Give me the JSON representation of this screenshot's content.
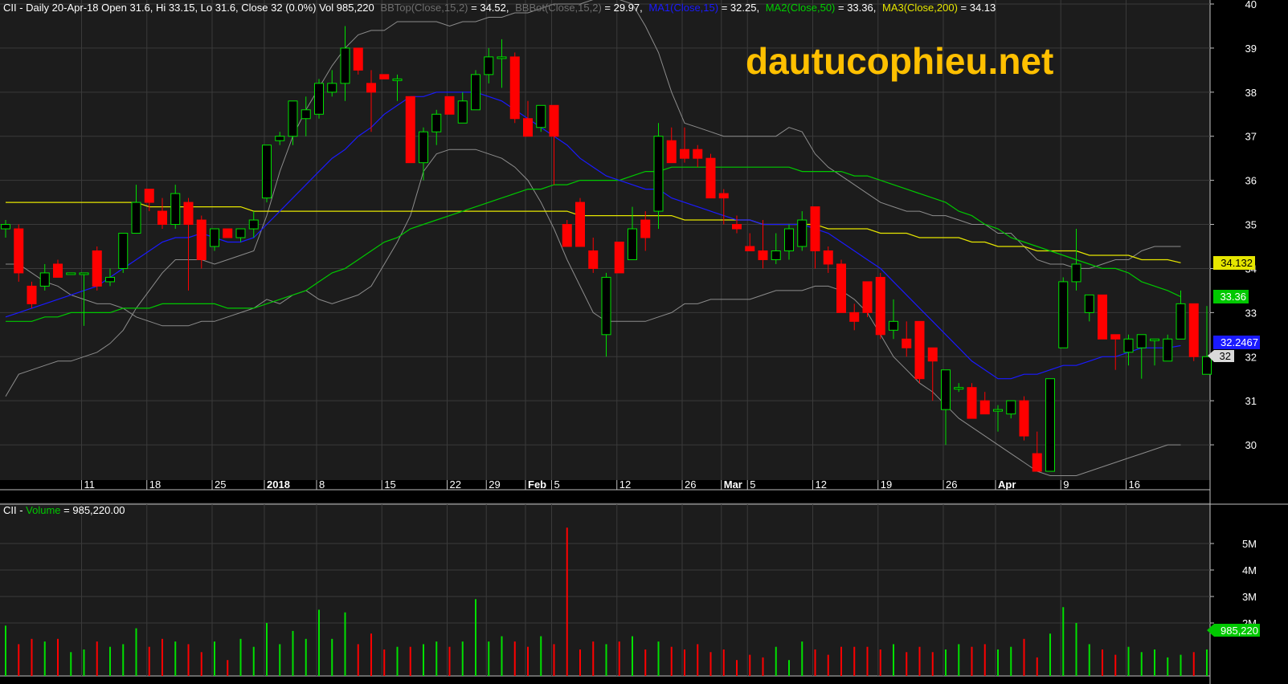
{
  "header": {
    "prefix": "CII - Daily 20-Apr-18 Open 31.6, Hi 33.15, Lo 31.6, Close 32 (0.0%) Vol 985,220",
    "bbtop_label": "BBTop(Close,15,2)",
    "bbtop_value": " = 34.52,",
    "bbbot_label": "BBBot(Close,15,2)",
    "bbbot_value": " = 29.97,",
    "ma1_label": "MA1(Close,15)",
    "ma1_value": " = 32.25,",
    "ma2_label": "MA2(Close,50)",
    "ma2_value": " = 33.36,",
    "ma3_label": "MA3(Close,200)",
    "ma3_value": " = 34.13"
  },
  "watermark": "dautucophieu.net",
  "volume_header": {
    "prefix": "CII - ",
    "label": "Volume",
    "value": " = 985,220.00"
  },
  "price_tags": {
    "ma3": "34.132",
    "ma2": "33.36",
    "ma1": "32.2467",
    "close": "32"
  },
  "volume_tag": "985,220",
  "colors": {
    "background": "#000000",
    "panel": "#1c1c1c",
    "grid": "#3a3a3a",
    "up": "#00e000",
    "down": "#ff0000",
    "bollinger": "#8c8c8c",
    "ma1": "#1a1aff",
    "ma2": "#00c800",
    "ma3": "#e6e600",
    "watermark": "#ffc000",
    "axis_text": "#ffffff"
  },
  "chart_data": {
    "type": "candlestick",
    "price_axis": {
      "ticks": [
        30,
        31,
        32,
        33,
        34,
        35,
        36,
        37,
        38,
        39,
        40
      ],
      "range": [
        29.2,
        40.0
      ]
    },
    "volume_axis": {
      "ticks": [
        "2M",
        "3M",
        "4M",
        "5M"
      ],
      "tick_values": [
        2,
        3,
        4,
        5
      ],
      "unit": "M"
    },
    "x_labels": [
      {
        "label": "11",
        "index": 6
      },
      {
        "label": "18",
        "index": 11
      },
      {
        "label": "25",
        "index": 16
      },
      {
        "label": "2018",
        "index": 20,
        "bold": true
      },
      {
        "label": "8",
        "index": 24
      },
      {
        "label": "15",
        "index": 29
      },
      {
        "label": "22",
        "index": 34
      },
      {
        "label": "29",
        "index": 37
      },
      {
        "label": "Feb",
        "index": 40,
        "bold": true
      },
      {
        "label": "5",
        "index": 42
      },
      {
        "label": "12",
        "index": 47
      },
      {
        "label": "26",
        "index": 52
      },
      {
        "label": "Mar",
        "index": 55,
        "bold": true
      },
      {
        "label": "5",
        "index": 57
      },
      {
        "label": "12",
        "index": 62
      },
      {
        "label": "19",
        "index": 67
      },
      {
        "label": "26",
        "index": 72
      },
      {
        "label": "Apr",
        "index": 76,
        "bold": true
      },
      {
        "label": "9",
        "index": 81
      },
      {
        "label": "16",
        "index": 86
      }
    ],
    "candles": [
      {
        "o": 34.9,
        "h": 35.1,
        "l": 34.7,
        "c": 35.0
      },
      {
        "o": 34.9,
        "h": 35.0,
        "l": 33.7,
        "c": 33.9
      },
      {
        "o": 33.6,
        "h": 33.7,
        "l": 33.1,
        "c": 33.2
      },
      {
        "o": 33.6,
        "h": 34.1,
        "l": 33.5,
        "c": 33.9
      },
      {
        "o": 34.1,
        "h": 34.2,
        "l": 33.8,
        "c": 33.8
      },
      {
        "o": 33.9,
        "h": 33.9,
        "l": 33.9,
        "c": 33.9
      },
      {
        "o": 33.9,
        "h": 33.9,
        "l": 32.7,
        "c": 33.9
      },
      {
        "o": 34.4,
        "h": 34.5,
        "l": 33.5,
        "c": 33.6
      },
      {
        "o": 33.7,
        "h": 34.0,
        "l": 33.6,
        "c": 33.8
      },
      {
        "o": 34.0,
        "h": 34.8,
        "l": 33.9,
        "c": 34.8
      },
      {
        "o": 34.8,
        "h": 35.9,
        "l": 34.8,
        "c": 35.5
      },
      {
        "o": 35.8,
        "h": 35.8,
        "l": 35.3,
        "c": 35.5
      },
      {
        "o": 35.3,
        "h": 35.6,
        "l": 34.9,
        "c": 35.0
      },
      {
        "o": 35.0,
        "h": 35.9,
        "l": 34.9,
        "c": 35.7
      },
      {
        "o": 35.5,
        "h": 35.6,
        "l": 33.5,
        "c": 35.0
      },
      {
        "o": 35.1,
        "h": 35.2,
        "l": 34.0,
        "c": 34.2
      },
      {
        "o": 34.5,
        "h": 34.9,
        "l": 34.4,
        "c": 34.9
      },
      {
        "o": 34.9,
        "h": 34.9,
        "l": 34.7,
        "c": 34.7
      },
      {
        "o": 34.7,
        "h": 34.9,
        "l": 34.6,
        "c": 34.9
      },
      {
        "o": 34.9,
        "h": 35.3,
        "l": 34.7,
        "c": 35.1
      },
      {
        "o": 35.6,
        "h": 36.8,
        "l": 35.5,
        "c": 36.8
      },
      {
        "o": 36.9,
        "h": 37.1,
        "l": 36.8,
        "c": 37.0
      },
      {
        "o": 37.0,
        "h": 37.8,
        "l": 36.8,
        "c": 37.8
      },
      {
        "o": 37.4,
        "h": 37.9,
        "l": 37.0,
        "c": 37.6
      },
      {
        "o": 37.5,
        "h": 38.3,
        "l": 37.4,
        "c": 38.2
      },
      {
        "o": 38.0,
        "h": 38.5,
        "l": 37.9,
        "c": 38.2
      },
      {
        "o": 38.2,
        "h": 39.5,
        "l": 37.8,
        "c": 39.0
      },
      {
        "o": 39.0,
        "h": 39.0,
        "l": 38.4,
        "c": 38.5
      },
      {
        "o": 38.2,
        "h": 38.5,
        "l": 37.1,
        "c": 38.0
      },
      {
        "o": 38.4,
        "h": 38.4,
        "l": 38.3,
        "c": 38.3
      },
      {
        "o": 38.3,
        "h": 38.4,
        "l": 37.8,
        "c": 38.3
      },
      {
        "o": 37.9,
        "h": 37.9,
        "l": 36.4,
        "c": 36.4
      },
      {
        "o": 36.4,
        "h": 37.2,
        "l": 36.0,
        "c": 37.1
      },
      {
        "o": 37.1,
        "h": 37.6,
        "l": 36.8,
        "c": 37.5
      },
      {
        "o": 37.9,
        "h": 37.9,
        "l": 37.5,
        "c": 37.5
      },
      {
        "o": 37.3,
        "h": 38.0,
        "l": 37.3,
        "c": 37.8
      },
      {
        "o": 37.6,
        "h": 38.5,
        "l": 37.6,
        "c": 38.4
      },
      {
        "o": 38.4,
        "h": 39.0,
        "l": 38.2,
        "c": 38.8
      },
      {
        "o": 38.8,
        "h": 39.2,
        "l": 38.1,
        "c": 38.8
      },
      {
        "o": 38.8,
        "h": 38.9,
        "l": 37.3,
        "c": 37.4
      },
      {
        "o": 37.4,
        "h": 37.8,
        "l": 37.0,
        "c": 37.0
      },
      {
        "o": 37.2,
        "h": 37.7,
        "l": 37.1,
        "c": 37.7
      },
      {
        "o": 37.7,
        "h": 37.7,
        "l": 35.9,
        "c": 37.0
      },
      {
        "o": 35.0,
        "h": 35.1,
        "l": 34.5,
        "c": 34.5
      },
      {
        "o": 35.5,
        "h": 35.6,
        "l": 34.5,
        "c": 34.5
      },
      {
        "o": 34.4,
        "h": 34.7,
        "l": 33.9,
        "c": 34.0
      },
      {
        "o": 32.5,
        "h": 33.9,
        "l": 32.0,
        "c": 33.8
      },
      {
        "o": 34.6,
        "h": 34.6,
        "l": 34.0,
        "c": 33.9
      },
      {
        "o": 34.2,
        "h": 35.4,
        "l": 34.2,
        "c": 34.9
      },
      {
        "o": 35.1,
        "h": 35.3,
        "l": 34.4,
        "c": 34.7
      },
      {
        "o": 35.3,
        "h": 37.3,
        "l": 34.9,
        "c": 37.0
      },
      {
        "o": 36.9,
        "h": 37.2,
        "l": 36.4,
        "c": 36.4
      },
      {
        "o": 36.7,
        "h": 37.2,
        "l": 36.4,
        "c": 36.5
      },
      {
        "o": 36.7,
        "h": 36.8,
        "l": 36.3,
        "c": 36.5
      },
      {
        "o": 36.5,
        "h": 36.6,
        "l": 35.6,
        "c": 35.6
      },
      {
        "o": 35.7,
        "h": 35.8,
        "l": 35.0,
        "c": 35.6
      },
      {
        "o": 35.0,
        "h": 35.2,
        "l": 34.8,
        "c": 34.9
      },
      {
        "o": 34.5,
        "h": 34.8,
        "l": 34.4,
        "c": 34.4
      },
      {
        "o": 34.4,
        "h": 35.1,
        "l": 34.0,
        "c": 34.2
      },
      {
        "o": 34.2,
        "h": 34.8,
        "l": 34.1,
        "c": 34.4
      },
      {
        "o": 34.4,
        "h": 35.0,
        "l": 34.2,
        "c": 34.9
      },
      {
        "o": 34.5,
        "h": 35.3,
        "l": 34.4,
        "c": 35.1
      },
      {
        "o": 35.4,
        "h": 35.4,
        "l": 34.0,
        "c": 34.4
      },
      {
        "o": 34.4,
        "h": 34.5,
        "l": 33.9,
        "c": 34.1
      },
      {
        "o": 34.1,
        "h": 34.2,
        "l": 33.1,
        "c": 33.0
      },
      {
        "o": 33.0,
        "h": 33.2,
        "l": 32.6,
        "c": 32.8
      },
      {
        "o": 33.7,
        "h": 33.7,
        "l": 32.9,
        "c": 33.0
      },
      {
        "o": 33.8,
        "h": 33.9,
        "l": 32.4,
        "c": 32.5
      },
      {
        "o": 32.6,
        "h": 33.3,
        "l": 32.4,
        "c": 32.8
      },
      {
        "o": 32.4,
        "h": 32.8,
        "l": 32.0,
        "c": 32.2
      },
      {
        "o": 32.8,
        "h": 32.8,
        "l": 31.4,
        "c": 31.5
      },
      {
        "o": 32.2,
        "h": 32.2,
        "l": 31.0,
        "c": 31.9
      },
      {
        "o": 30.8,
        "h": 31.7,
        "l": 30.0,
        "c": 31.7
      },
      {
        "o": 31.3,
        "h": 31.4,
        "l": 31.2,
        "c": 31.3
      },
      {
        "o": 31.3,
        "h": 31.4,
        "l": 30.6,
        "c": 30.6
      },
      {
        "o": 31.0,
        "h": 31.2,
        "l": 30.7,
        "c": 30.7
      },
      {
        "o": 30.8,
        "h": 30.9,
        "l": 30.3,
        "c": 30.8
      },
      {
        "o": 30.7,
        "h": 31.0,
        "l": 30.6,
        "c": 31.0
      },
      {
        "o": 31.0,
        "h": 31.1,
        "l": 30.1,
        "c": 30.2
      },
      {
        "o": 29.8,
        "h": 30.3,
        "l": 29.4,
        "c": 29.4
      },
      {
        "o": 29.4,
        "h": 31.5,
        "l": 29.4,
        "c": 31.5
      },
      {
        "o": 32.2,
        "h": 33.8,
        "l": 32.2,
        "c": 33.7
      },
      {
        "o": 33.7,
        "h": 34.9,
        "l": 33.5,
        "c": 34.1
      },
      {
        "o": 33.0,
        "h": 33.4,
        "l": 32.8,
        "c": 33.4
      },
      {
        "o": 33.4,
        "h": 33.4,
        "l": 32.5,
        "c": 32.4
      },
      {
        "o": 32.5,
        "h": 32.5,
        "l": 31.7,
        "c": 32.4
      },
      {
        "o": 32.1,
        "h": 32.5,
        "l": 31.8,
        "c": 32.4
      },
      {
        "o": 32.2,
        "h": 32.4,
        "l": 31.5,
        "c": 32.5
      },
      {
        "o": 32.4,
        "h": 32.4,
        "l": 31.8,
        "c": 32.4
      },
      {
        "o": 31.9,
        "h": 32.5,
        "l": 31.9,
        "c": 32.4
      },
      {
        "o": 32.4,
        "h": 33.5,
        "l": 32.4,
        "c": 33.2
      },
      {
        "o": 33.2,
        "h": 33.2,
        "l": 31.9,
        "c": 32.0
      },
      {
        "o": 31.6,
        "h": 33.15,
        "l": 31.6,
        "c": 32.0
      }
    ],
    "volume": [
      1.9,
      1.2,
      1.4,
      1.3,
      1.4,
      0.9,
      1.0,
      1.3,
      1.1,
      1.2,
      1.8,
      1.1,
      1.4,
      1.3,
      1.2,
      0.9,
      1.3,
      0.6,
      1.4,
      1.1,
      2.0,
      1.2,
      1.7,
      1.4,
      2.5,
      1.4,
      2.4,
      1.2,
      1.6,
      1.0,
      1.1,
      1.1,
      1.2,
      1.3,
      1.1,
      1.3,
      2.9,
      1.3,
      1.5,
      1.3,
      1.1,
      1.5,
      1.2,
      5.6,
      1.0,
      1.3,
      1.2,
      1.3,
      1.5,
      1.0,
      1.3,
      1.1,
      1.0,
      1.2,
      0.9,
      1.0,
      0.6,
      0.8,
      0.7,
      1.1,
      0.6,
      1.3,
      1.0,
      0.8,
      1.1,
      1.1,
      1.1,
      1.0,
      1.2,
      0.9,
      1.1,
      0.9,
      1.0,
      1.2,
      1.1,
      1.2,
      1.0,
      1.1,
      1.4,
      0.7,
      1.6,
      2.6,
      2.0,
      1.2,
      1.0,
      0.8,
      1.1,
      0.9,
      1.0,
      0.7,
      0.8,
      0.9,
      1.0
    ],
    "bb_top": [
      31.1,
      31.6,
      31.7,
      31.8,
      31.9,
      31.9,
      32.0,
      32.1,
      32.3,
      32.6,
      33.1,
      33.5,
      33.9,
      34.2,
      34.2,
      34.2,
      34.1,
      34.2,
      34.3,
      34.4,
      35.2,
      36.2,
      37.0,
      37.6,
      38.1,
      38.6,
      39.0,
      39.3,
      39.4,
      39.4,
      39.6,
      39.6,
      39.6,
      39.6,
      39.5,
      39.6,
      39.6,
      39.7,
      39.7,
      39.8,
      39.8,
      39.9,
      40.0,
      40.0,
      40.0,
      40.1,
      40.2,
      40.1,
      40.0,
      39.5,
      38.9,
      38.0,
      37.3,
      37.2,
      37.1,
      37.0,
      37.0,
      37.0,
      37.0,
      37.0,
      37.2,
      37.1,
      36.6,
      36.3,
      36.1,
      35.9,
      35.7,
      35.5,
      35.4,
      35.3,
      35.3,
      35.2,
      35.2,
      35.1,
      35.0,
      35.0,
      34.8,
      34.8,
      34.5,
      34.2,
      34.1,
      34.1,
      34.0,
      34.0,
      34.1,
      34.2,
      34.2,
      34.4,
      34.5,
      34.5,
      34.5
    ],
    "bb_bot": [
      34.1,
      34.1,
      33.9,
      33.7,
      33.6,
      33.4,
      33.3,
      33.2,
      33.2,
      33.1,
      32.9,
      32.8,
      32.7,
      32.7,
      32.7,
      32.8,
      32.8,
      32.9,
      33.0,
      33.1,
      33.3,
      33.2,
      33.4,
      33.5,
      33.3,
      33.2,
      33.3,
      33.4,
      33.6,
      34.1,
      34.6,
      35.2,
      36.2,
      36.6,
      36.7,
      36.7,
      36.7,
      36.6,
      36.5,
      36.3,
      36.0,
      35.5,
      34.9,
      34.2,
      33.6,
      33.0,
      32.8,
      32.8,
      32.8,
      32.8,
      32.9,
      33.0,
      33.2,
      33.2,
      33.3,
      33.3,
      33.3,
      33.3,
      33.4,
      33.5,
      33.5,
      33.5,
      33.6,
      33.6,
      33.5,
      33.3,
      33.0,
      32.5,
      32.0,
      31.7,
      31.4,
      31.2,
      30.9,
      30.6,
      30.4,
      30.2,
      30.0,
      29.8,
      29.6,
      29.4,
      29.3,
      29.3,
      29.3,
      29.4,
      29.5,
      29.6,
      29.7,
      29.8,
      29.9,
      30.0,
      30.0
    ],
    "ma1": [
      32.9,
      33.0,
      33.1,
      33.2,
      33.3,
      33.4,
      33.5,
      33.6,
      33.8,
      34.0,
      34.2,
      34.4,
      34.6,
      34.7,
      34.7,
      34.8,
      34.7,
      34.6,
      34.6,
      34.7,
      35.0,
      35.3,
      35.6,
      35.9,
      36.2,
      36.5,
      36.7,
      37.0,
      37.2,
      37.5,
      37.7,
      37.9,
      37.9,
      38.0,
      38.0,
      38.0,
      38.0,
      37.9,
      37.8,
      37.6,
      37.4,
      37.2,
      37.0,
      36.8,
      36.5,
      36.3,
      36.1,
      36.0,
      35.9,
      35.8,
      35.8,
      35.6,
      35.5,
      35.4,
      35.3,
      35.2,
      35.1,
      35.1,
      35.0,
      35.0,
      35.0,
      35.0,
      34.9,
      34.8,
      34.6,
      34.4,
      34.2,
      34.0,
      33.7,
      33.4,
      33.1,
      32.8,
      32.5,
      32.2,
      31.9,
      31.7,
      31.5,
      31.5,
      31.6,
      31.6,
      31.7,
      31.8,
      31.8,
      31.9,
      32.0,
      32.0,
      32.1,
      32.2,
      32.2,
      32.2,
      32.25
    ],
    "ma2": [
      32.8,
      32.8,
      32.8,
      32.9,
      32.9,
      33.0,
      33.0,
      33.0,
      33.0,
      33.1,
      33.1,
      33.1,
      33.2,
      33.2,
      33.2,
      33.2,
      33.2,
      33.1,
      33.1,
      33.1,
      33.2,
      33.3,
      33.4,
      33.5,
      33.7,
      33.9,
      34.0,
      34.2,
      34.4,
      34.6,
      34.7,
      34.9,
      35.0,
      35.1,
      35.2,
      35.3,
      35.4,
      35.5,
      35.6,
      35.7,
      35.8,
      35.8,
      35.9,
      35.9,
      36.0,
      36.0,
      36.0,
      36.0,
      36.1,
      36.2,
      36.2,
      36.3,
      36.3,
      36.3,
      36.3,
      36.3,
      36.3,
      36.3,
      36.3,
      36.3,
      36.3,
      36.2,
      36.2,
      36.2,
      36.2,
      36.1,
      36.1,
      36.0,
      35.9,
      35.8,
      35.7,
      35.6,
      35.5,
      35.3,
      35.2,
      35.0,
      34.9,
      34.7,
      34.6,
      34.5,
      34.4,
      34.3,
      34.2,
      34.1,
      34.0,
      34.0,
      33.9,
      33.7,
      33.6,
      33.5,
      33.36
    ],
    "ma3": [
      35.5,
      35.5,
      35.5,
      35.5,
      35.5,
      35.5,
      35.5,
      35.5,
      35.5,
      35.5,
      35.5,
      35.4,
      35.4,
      35.4,
      35.4,
      35.4,
      35.4,
      35.4,
      35.4,
      35.3,
      35.3,
      35.3,
      35.3,
      35.3,
      35.3,
      35.3,
      35.3,
      35.3,
      35.3,
      35.3,
      35.3,
      35.3,
      35.3,
      35.3,
      35.3,
      35.3,
      35.3,
      35.3,
      35.3,
      35.3,
      35.3,
      35.3,
      35.3,
      35.3,
      35.2,
      35.2,
      35.2,
      35.2,
      35.2,
      35.2,
      35.2,
      35.2,
      35.1,
      35.1,
      35.1,
      35.1,
      35.1,
      35.1,
      35.0,
      35.0,
      35.0,
      35.0,
      35.0,
      34.9,
      34.9,
      34.9,
      34.9,
      34.8,
      34.8,
      34.8,
      34.7,
      34.7,
      34.7,
      34.7,
      34.6,
      34.6,
      34.5,
      34.5,
      34.5,
      34.4,
      34.4,
      34.4,
      34.4,
      34.3,
      34.3,
      34.3,
      34.3,
      34.2,
      34.2,
      34.2,
      34.13
    ]
  }
}
